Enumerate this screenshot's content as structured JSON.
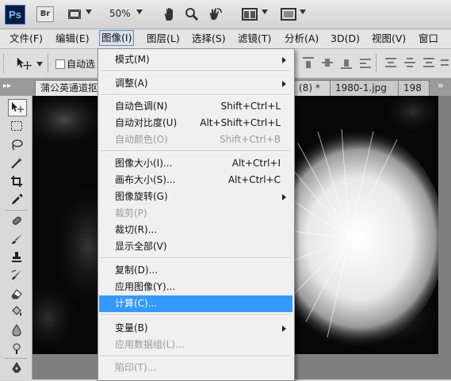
{
  "appbar": {
    "logo": "Ps",
    "bridge": "Br",
    "zoom": "50%"
  },
  "menubar": {
    "items": [
      "文件(F)",
      "编辑(E)",
      "图像(I)",
      "图层(L)",
      "选择(S)",
      "滤镜(T)",
      "分析(A)",
      "3D(D)",
      "视图(V)",
      "窗口"
    ]
  },
  "options": {
    "auto_select_label": "自动选"
  },
  "tabs": {
    "items": [
      "蒲公英通道抠",
      "(8) *",
      "1980-1.jpg",
      "198"
    ],
    "overflow": "»"
  },
  "image_menu": {
    "items": [
      {
        "label": "模式(M)",
        "shortcut": "",
        "submenu": true,
        "disabled": false
      },
      {
        "label": "调整(A)",
        "shortcut": "",
        "submenu": true,
        "disabled": false
      },
      {
        "label": "自动色调(N)",
        "shortcut": "Shift+Ctrl+L",
        "submenu": false,
        "disabled": false
      },
      {
        "label": "自动对比度(U)",
        "shortcut": "Alt+Shift+Ctrl+L",
        "submenu": false,
        "disabled": false
      },
      {
        "label": "自动颜色(O)",
        "shortcut": "Shift+Ctrl+B",
        "submenu": false,
        "disabled": true
      },
      {
        "label": "图像大小(I)...",
        "shortcut": "Alt+Ctrl+I",
        "submenu": false,
        "disabled": false
      },
      {
        "label": "画布大小(S)...",
        "shortcut": "Alt+Ctrl+C",
        "submenu": false,
        "disabled": false
      },
      {
        "label": "图像旋转(G)",
        "shortcut": "",
        "submenu": true,
        "disabled": false
      },
      {
        "label": "裁剪(P)",
        "shortcut": "",
        "submenu": false,
        "disabled": true
      },
      {
        "label": "裁切(R)...",
        "shortcut": "",
        "submenu": false,
        "disabled": false
      },
      {
        "label": "显示全部(V)",
        "shortcut": "",
        "submenu": false,
        "disabled": false
      },
      {
        "label": "复制(D)...",
        "shortcut": "",
        "submenu": false,
        "disabled": false
      },
      {
        "label": "应用图像(Y)...",
        "shortcut": "",
        "submenu": false,
        "disabled": false
      },
      {
        "label": "计算(C)...",
        "shortcut": "",
        "submenu": false,
        "disabled": false,
        "highlighted": true
      },
      {
        "label": "变量(B)",
        "shortcut": "",
        "submenu": true,
        "disabled": false
      },
      {
        "label": "应用数据组(L)...",
        "shortcut": "",
        "submenu": false,
        "disabled": true
      },
      {
        "label": "陷印(T)...",
        "shortcut": "",
        "submenu": false,
        "disabled": true
      }
    ]
  },
  "colors": {
    "highlight": "#3399ff",
    "disabled_text": "#9a9a9a",
    "menu_bg": "#f0f0f0"
  },
  "icons": [
    "photoshop-logo",
    "bridge-logo",
    "film-strip-icon",
    "hand-icon",
    "zoom-icon",
    "rotate-view-icon",
    "arrange-documents-icon",
    "screen-mode-icon",
    "move-tool-icon"
  ]
}
